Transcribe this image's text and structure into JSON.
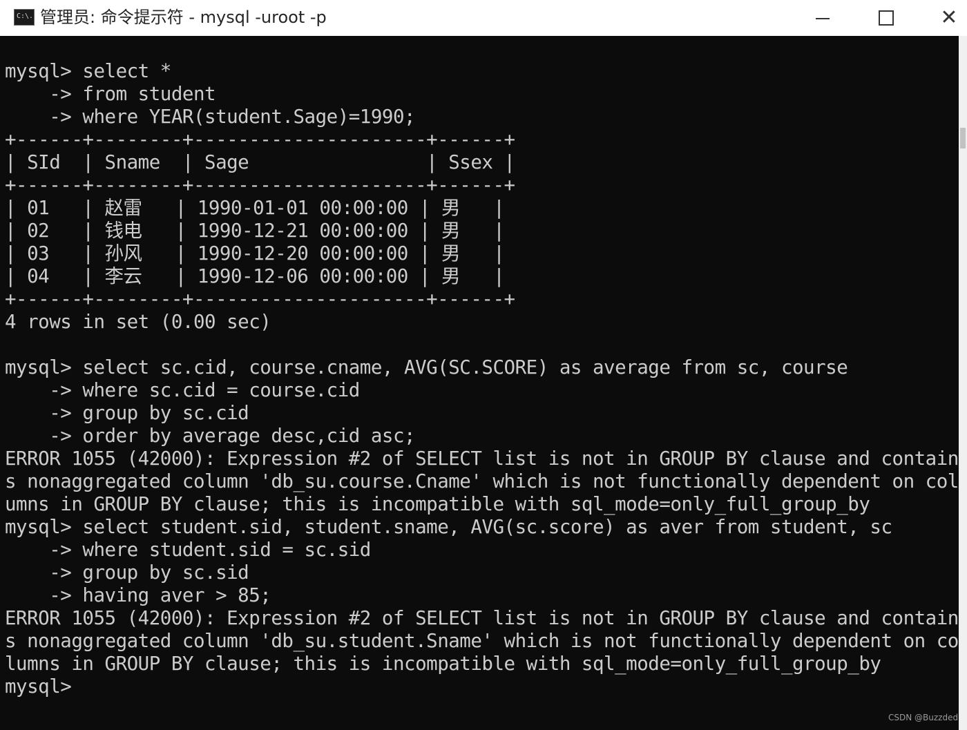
{
  "window": {
    "icon_text": "C:\\.",
    "title": "管理员: 命令提示符 - mysql  -uroot -p",
    "minimize_label": "minimize",
    "maximize_label": "maximize",
    "close_label": "close"
  },
  "console": {
    "lines": [
      "mysql> select *",
      "    -> from student",
      "    -> where YEAR(student.Sage)=1990;",
      "+------+--------+---------------------+------+",
      "| SId  | Sname  | Sage                | Ssex |",
      "+------+--------+---------------------+------+",
      "| 01   | 赵雷   | 1990-01-01 00:00:00 | 男   |",
      "| 02   | 钱电   | 1990-12-21 00:00:00 | 男   |",
      "| 03   | 孙风   | 1990-12-20 00:00:00 | 男   |",
      "| 04   | 李云   | 1990-12-06 00:00:00 | 男   |",
      "+------+--------+---------------------+------+",
      "4 rows in set (0.00 sec)",
      "",
      "mysql> select sc.cid, course.cname, AVG(SC.SCORE) as average from sc, course",
      "    -> where sc.cid = course.cid",
      "    -> group by sc.cid",
      "    -> order by average desc,cid asc;",
      "ERROR 1055 (42000): Expression #2 of SELECT list is not in GROUP BY clause and contain",
      "s nonaggregated column 'db_su.course.Cname' which is not functionally dependent on col",
      "umns in GROUP BY clause; this is incompatible with sql_mode=only_full_group_by",
      "mysql> select student.sid, student.sname, AVG(sc.score) as aver from student, sc",
      "    -> where student.sid = sc.sid",
      "    -> group by sc.sid",
      "    -> having aver > 85;",
      "ERROR 1055 (42000): Expression #2 of SELECT list is not in GROUP BY clause and contain",
      "s nonaggregated column 'db_su.student.Sname' which is not functionally dependent on co",
      "lumns in GROUP BY clause; this is incompatible with sql_mode=only_full_group_by",
      "mysql>"
    ]
  },
  "watermark": "CSDN @Buzzded"
}
